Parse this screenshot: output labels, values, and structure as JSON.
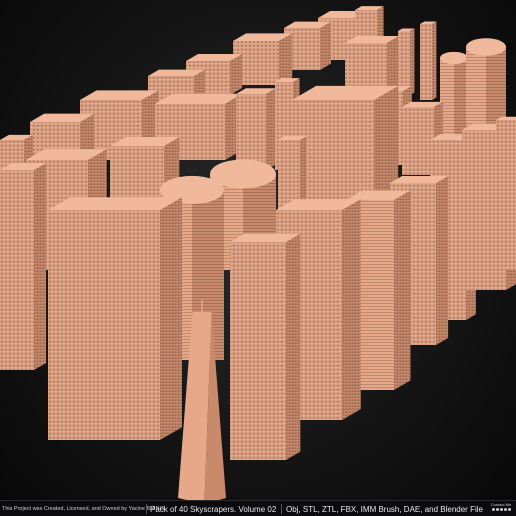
{
  "image": {
    "subject": "3D render of 40 skyscraper models",
    "colors": {
      "building_light": "#e6a889",
      "building_mid": "#c9896b",
      "building_dark": "#8a5843",
      "background": "#151516"
    }
  },
  "footer": {
    "credit": "This Project was Created, Licensed, and Owned by Yacine BRINIS",
    "title": "Pack of 40 Skyscrapers. Volume 02",
    "formats": "Obj, STL, ZTL, FBX, IMM Brush, DAE, and Blender File",
    "logo_caption": "Contact Me"
  }
}
